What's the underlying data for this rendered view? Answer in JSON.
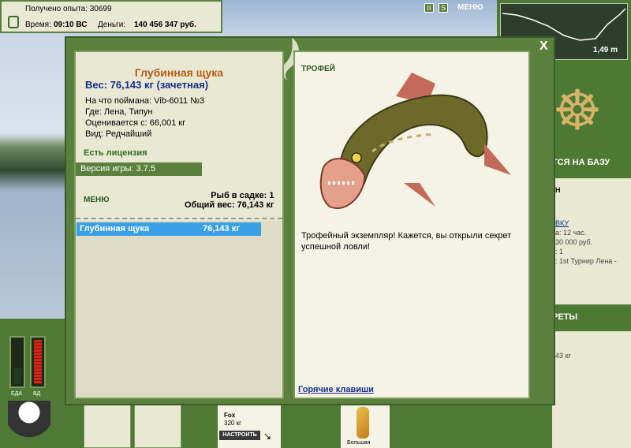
{
  "topbar": {
    "experience_label": "Получено опыта: 30699",
    "time_label": "Время:",
    "time_value": "09:10 ВС",
    "money_label": "Деньги:",
    "money_value": "140 456 347 руб."
  },
  "map": {
    "depth": "1,49 m"
  },
  "topmenu": {
    "label": "МЕНЮ",
    "icon1": "II",
    "icon2": "S"
  },
  "right": {
    "to_base": "ТСЯ НА БАЗУ",
    "h": "Н",
    "link": "ВКУ",
    "l1": "а: 12 час.",
    "l2": "30 000 руб.",
    "l3": ": 1",
    "l4": ": 1st Турнир Лена -",
    "secrets": "РЕТЫ",
    "kg": "43 кг"
  },
  "bottom": {
    "eat_label": "ЕДА",
    "dr_label": "ВД",
    "rod_name": "Fox",
    "rod_weight": "320 кг",
    "setup_button": "НАСТРОИТЬ",
    "lure_label": "Большая"
  },
  "dialog": {
    "close": "X",
    "fish_name": "Глубинная щука",
    "weight": "Вес: 76,143 кг (зачетная)",
    "caught_on": "На что поймана: Vib-6011 №3",
    "where": "Где: Лена, Типун",
    "valued_from": "Оценивается с: 66,001 кг",
    "kind": "Вид: Редчайший",
    "license": "Есть лицензия",
    "version": "Версия игры: 3.7.5",
    "menu": "МЕНЮ",
    "fish_in_cage": "Рыб в садке: 1",
    "total_weight": "Общий вес: 76,143 кг",
    "list": [
      {
        "name": "Глубинная щука",
        "weight": "76,143 кг"
      }
    ],
    "trophy_header": "ТРОФЕЙ",
    "trophy_text": "Трофейный экземпляр! Кажется, вы открыли секрет успешной ловли!",
    "hotkeys": "Горячие клавиши"
  },
  "colors": {
    "panel_green": "#5b7f3d",
    "accent_orange": "#b85c12",
    "select_blue": "#3aa0e6",
    "link_blue": "#1a2e8a"
  }
}
